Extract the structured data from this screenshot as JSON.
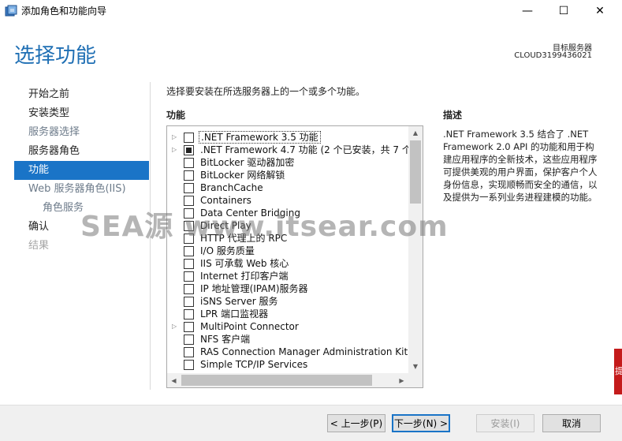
{
  "window": {
    "title": "添加角色和功能向导",
    "minimize_glyph": "—",
    "maximize_glyph": "☐",
    "close_glyph": "✕"
  },
  "header": {
    "title": "选择功能",
    "target_label": "目标服务器",
    "target_name": "CLOUD3199436021"
  },
  "nav": {
    "items": [
      {
        "label": "开始之前",
        "state": "normal"
      },
      {
        "label": "安装类型",
        "state": "normal"
      },
      {
        "label": "服务器选择",
        "state": "muted"
      },
      {
        "label": "服务器角色",
        "state": "normal"
      },
      {
        "label": "功能",
        "state": "active"
      },
      {
        "label": "Web 服务器角色(IIS)",
        "state": "muted"
      },
      {
        "label": "角色服务",
        "state": "muted-sub"
      },
      {
        "label": "确认",
        "state": "normal"
      },
      {
        "label": "结果",
        "state": "disabled"
      }
    ]
  },
  "main": {
    "instruction": "选择要安装在所选服务器上的一个或多个功能。",
    "features_heading": "功能",
    "description_heading": "描述",
    "description": ".NET Framework 3.5 结合了 .NET Framework 2.0 API 的功能和用于构建应用程序的全新技术，这些应用程序可提供美观的用户界面，保护客户个人身份信息，实现顺畅而安全的通信，以及提供为一系列业务进程建模的功能。",
    "features": [
      {
        "label": ".NET Framework 3.5 功能",
        "expandable": true,
        "check": "none",
        "selected": true
      },
      {
        "label": ".NET Framework 4.7 功能 (2 个已安装，共 7 个)",
        "expandable": true,
        "check": "partial",
        "selected": false
      },
      {
        "label": "BitLocker 驱动器加密",
        "expandable": false,
        "check": "none",
        "selected": false
      },
      {
        "label": "BitLocker 网络解锁",
        "expandable": false,
        "check": "none",
        "selected": false
      },
      {
        "label": "BranchCache",
        "expandable": false,
        "check": "none",
        "selected": false
      },
      {
        "label": "Containers",
        "expandable": false,
        "check": "none",
        "selected": false
      },
      {
        "label": "Data Center Bridging",
        "expandable": false,
        "check": "none",
        "selected": false
      },
      {
        "label": "Direct Play",
        "expandable": false,
        "check": "none",
        "selected": false
      },
      {
        "label": "HTTP 代理上的 RPC",
        "expandable": false,
        "check": "none",
        "selected": false
      },
      {
        "label": "I/O 服务质量",
        "expandable": false,
        "check": "none",
        "selected": false
      },
      {
        "label": "IIS 可承载 Web 核心",
        "expandable": false,
        "check": "none",
        "selected": false
      },
      {
        "label": "Internet 打印客户端",
        "expandable": false,
        "check": "none",
        "selected": false
      },
      {
        "label": "IP 地址管理(IPAM)服务器",
        "expandable": false,
        "check": "none",
        "selected": false
      },
      {
        "label": "iSNS Server 服务",
        "expandable": false,
        "check": "none",
        "selected": false
      },
      {
        "label": "LPR 端口监视器",
        "expandable": false,
        "check": "none",
        "selected": false
      },
      {
        "label": "MultiPoint Connector",
        "expandable": true,
        "check": "none",
        "selected": false
      },
      {
        "label": "NFS 客户端",
        "expandable": false,
        "check": "none",
        "selected": false
      },
      {
        "label": "RAS Connection Manager Administration Kit (",
        "expandable": false,
        "check": "none",
        "selected": false
      },
      {
        "label": "Simple TCP/IP Services",
        "expandable": false,
        "check": "none",
        "selected": false
      }
    ]
  },
  "watermark": "SEA源 www.itsear.com",
  "footer": {
    "prev_label": "< 上一步(P)",
    "next_label": "下一步(N) >",
    "install_label": "安装(I)",
    "cancel_label": "取消"
  },
  "edge_glyph": "提",
  "colors": {
    "accent": "#1a74c7",
    "title_blue": "#1f6fb4",
    "footer_bg": "#f0f0f0"
  }
}
